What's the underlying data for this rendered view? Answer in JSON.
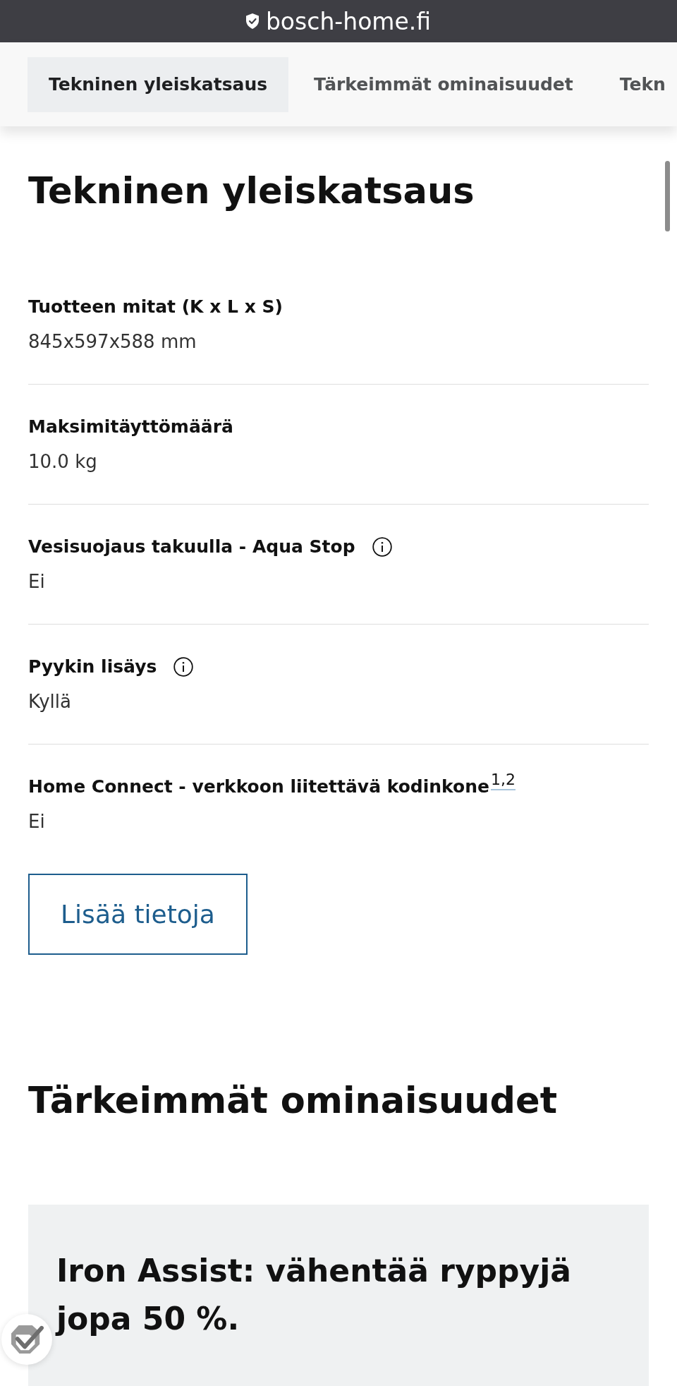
{
  "address_bar": {
    "url": "bosch-home.fi"
  },
  "tabs": [
    {
      "label": "Tekninen yleiskatsaus",
      "selected": true
    },
    {
      "label": "Tärkeimmät ominaisuudet",
      "selected": false
    },
    {
      "label": "Tekn",
      "selected": false
    }
  ],
  "technical_overview": {
    "title": "Tekninen yleiskatsaus",
    "specs": [
      {
        "label": "Tuotteen mitat (K x L x S)",
        "value": "845x597x588 mm",
        "info": false
      },
      {
        "label": "Maksimitäyttömäärä",
        "value": "10.0 kg",
        "info": false
      },
      {
        "label": "Vesisuojaus takuulla - Aqua Stop",
        "value": "Ei",
        "info": true
      },
      {
        "label": "Pyykin lisäys",
        "value": "Kyllä",
        "info": true
      },
      {
        "label": "Home Connect - verkkoon liitettävä kodinkone$^{1,2}$",
        "value": "Ei",
        "info": false
      }
    ],
    "more_button": "Lisää tietoja"
  },
  "key_features": {
    "title": "Tärkeimmät ominaisuudet",
    "cards": [
      {
        "title": "Iron Assist: vähentää ryppyjä jopa 50 %."
      }
    ]
  }
}
